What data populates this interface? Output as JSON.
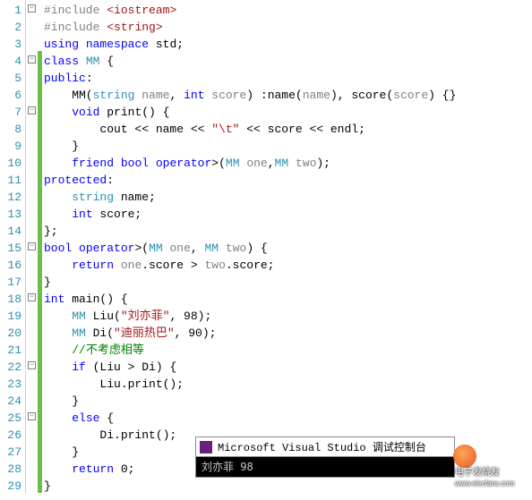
{
  "lines": {
    "count": 29,
    "numbers": [
      "1",
      "2",
      "3",
      "4",
      "5",
      "6",
      "7",
      "8",
      "9",
      "10",
      "11",
      "12",
      "13",
      "14",
      "15",
      "16",
      "17",
      "18",
      "19",
      "20",
      "21",
      "22",
      "23",
      "24",
      "25",
      "26",
      "27",
      "28",
      "29"
    ]
  },
  "fold": {
    "marks": {
      "1": "minus",
      "4": "minus",
      "7": "minus",
      "15": "minus",
      "18": "minus",
      "22": "minus",
      "25": "minus"
    }
  },
  "code": {
    "l1_a": "#include",
    "l1_b": " ",
    "l1_c": "<iostream>",
    "l2_a": "#include",
    "l2_b": " ",
    "l2_c": "<string>",
    "l3_a": "using",
    "l3_b": " ",
    "l3_c": "namespace",
    "l3_d": " std;",
    "l4_a": "class",
    "l4_b": " ",
    "l4_c": "MM",
    "l4_d": " {",
    "l5_a": "public",
    "l5_b": ":",
    "l6_a": "    MM(",
    "l6_b": "string",
    "l6_c": " ",
    "l6_d": "name",
    "l6_e": ", ",
    "l6_f": "int",
    "l6_g": " ",
    "l6_h": "score",
    "l6_i": ") :name(",
    "l6_j": "name",
    "l6_k": "), score(",
    "l6_l": "score",
    "l6_m": ") {}",
    "l7_a": "    ",
    "l7_b": "void",
    "l7_c": " print() {",
    "l8_a": "        cout << name << ",
    "l8_b": "\"\\t\"",
    "l8_c": " << score << endl;",
    "l9_a": "    }",
    "l10_a": "    ",
    "l10_b": "friend",
    "l10_c": " ",
    "l10_d": "bool",
    "l10_e": " ",
    "l10_f": "operator",
    "l10_g": ">(",
    "l10_h": "MM",
    "l10_i": " ",
    "l10_j": "one",
    "l10_k": ",",
    "l10_l": "MM",
    "l10_m": " ",
    "l10_n": "two",
    "l10_o": ");",
    "l11_a": "protected",
    "l11_b": ":",
    "l12_a": "    ",
    "l12_b": "string",
    "l12_c": " name;",
    "l13_a": "    ",
    "l13_b": "int",
    "l13_c": " score;",
    "l14_a": "};",
    "l15_a": "bool",
    "l15_b": " ",
    "l15_c": "operator",
    "l15_d": ">(",
    "l15_e": "MM",
    "l15_f": " ",
    "l15_g": "one",
    "l15_h": ", ",
    "l15_i": "MM",
    "l15_j": " ",
    "l15_k": "two",
    "l15_l": ") {",
    "l16_a": "    ",
    "l16_b": "return",
    "l16_c": " ",
    "l16_d": "one",
    "l16_e": ".score > ",
    "l16_f": "two",
    "l16_g": ".score;",
    "l17_a": "}",
    "l18_a": "int",
    "l18_b": " main() {",
    "l19_a": "    ",
    "l19_b": "MM",
    "l19_c": " Liu(",
    "l19_d": "\"刘亦菲\"",
    "l19_e": ", 98);",
    "l20_a": "    ",
    "l20_b": "MM",
    "l20_c": " Di(",
    "l20_d": "\"迪丽热巴\"",
    "l20_e": ", 90);",
    "l21_a": "    ",
    "l21_b": "//不考虑相等",
    "l22_a": "    ",
    "l22_b": "if",
    "l22_c": " (Liu > Di) {",
    "l23_a": "        Liu.print();",
    "l24_a": "    }",
    "l25_a": "    ",
    "l25_b": "else",
    "l25_c": " {",
    "l26_a": "        Di.print();",
    "l27_a": "    }",
    "l28_a": "    ",
    "l28_b": "return",
    "l28_c": " 0;",
    "l29_a": "}"
  },
  "console": {
    "title": "Microsoft Visual Studio 调试控制台",
    "output": "刘亦菲   98"
  },
  "watermark": {
    "line1": "电子发烧友",
    "line2": "www.elecfans.com"
  }
}
